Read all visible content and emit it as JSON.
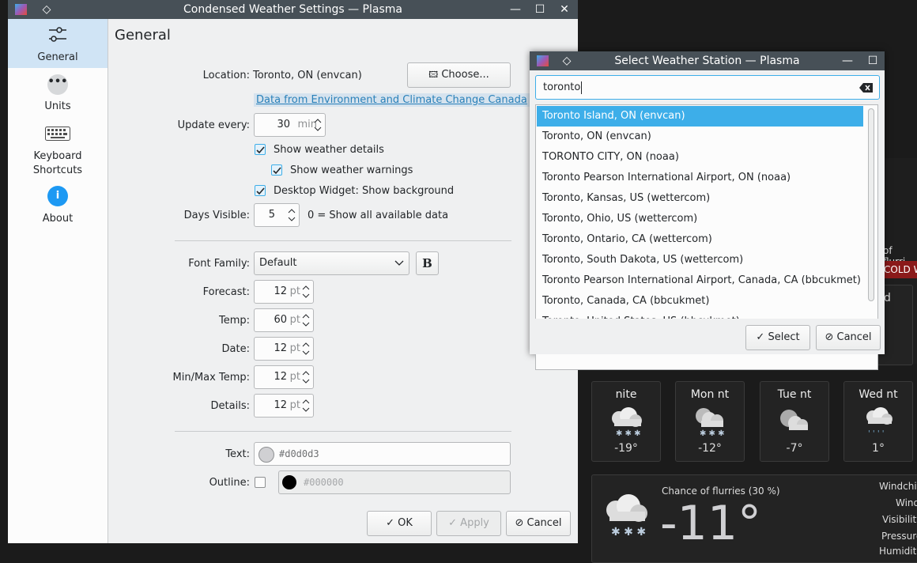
{
  "main_window": {
    "title": "Condensed Weather Settings — Plasma",
    "sidebar": [
      {
        "label": "General",
        "icon": "sliders-icon"
      },
      {
        "label": "Units",
        "icon": "ellipsis-icon"
      },
      {
        "label": "Keyboard Shortcuts",
        "icon": "keyboard-icon"
      },
      {
        "label": "About",
        "icon": "info-icon"
      }
    ],
    "page_title": "General",
    "location": {
      "label": "Location:",
      "value": "Toronto, ON (envcan)",
      "button": "Choose..."
    },
    "data_source_link": "Data from Environment and Climate Change Canada",
    "update_every": {
      "label": "Update every:",
      "value": "30",
      "unit": "min"
    },
    "show_weather_details": {
      "label": "Show weather details",
      "checked": true
    },
    "show_weather_warnings": {
      "label": "Show weather warnings",
      "checked": true
    },
    "desktop_widget_bg": {
      "label": "Desktop Widget: Show background",
      "checked": true
    },
    "days_visible": {
      "label": "Days Visible:",
      "value": "5",
      "hint": "0 = Show all available data"
    },
    "font_family": {
      "label": "Font Family:",
      "value": "Default",
      "bold_button": "B"
    },
    "sizes": [
      {
        "label": "Forecast:",
        "value": "12",
        "unit": "pt"
      },
      {
        "label": "Temp:",
        "value": "60",
        "unit": "pt"
      },
      {
        "label": "Date:",
        "value": "12",
        "unit": "pt"
      },
      {
        "label": "Min/Max Temp:",
        "value": "12",
        "unit": "pt"
      },
      {
        "label": "Details:",
        "value": "12",
        "unit": "pt"
      }
    ],
    "text_color": {
      "label": "Text:",
      "value": "#d0d0d3"
    },
    "outline_color": {
      "label": "Outline:",
      "value": "#000000",
      "checked": false
    },
    "buttons": {
      "ok": "OK",
      "apply": "Apply",
      "cancel": "Cancel"
    }
  },
  "dialog": {
    "title": "Select Weather Station — Plasma",
    "search_value": "toronto",
    "stations": [
      "Toronto Island, ON (envcan)",
      "Toronto, ON (envcan)",
      "TORONTO CITY, ON (noaa)",
      "Toronto Pearson International Airport, ON (noaa)",
      "Toronto, Kansas, US (wettercom)",
      "Toronto, Ohio, US (wettercom)",
      "Toronto, Ontario, CA (wettercom)",
      "Toronto, South Dakota, US (wettercom)",
      "Toronto Pearson International Airport, Canada, CA (bbcukmet)",
      "Toronto, Canada, CA (bbcukmet)",
      "Toronto, United States, US (bbcukmet)"
    ],
    "selected_index": 0,
    "buttons": {
      "select": "Select",
      "cancel": "Cancel"
    }
  },
  "widget": {
    "partial_text_1": "of flurri",
    "partial_text_2": "COLD W",
    "partial_text_3": "d",
    "forecast": [
      {
        "day": "nite",
        "temp": "-19°",
        "icon": "snow-cloud-icon"
      },
      {
        "day": "Mon nt",
        "temp": "-12°",
        "icon": "moon-snow-icon"
      },
      {
        "day": "Tue nt",
        "temp": "-7°",
        "icon": "moon-cloud-icon"
      },
      {
        "day": "Wed nt",
        "temp": "1°",
        "icon": "rain-cloud-icon"
      }
    ],
    "current": {
      "condition": "Chance of flurries (30 %)",
      "temp": "-11°",
      "details": [
        "Windchil",
        "Wind",
        "Visibility",
        "Pressure",
        "Humidit"
      ]
    }
  }
}
